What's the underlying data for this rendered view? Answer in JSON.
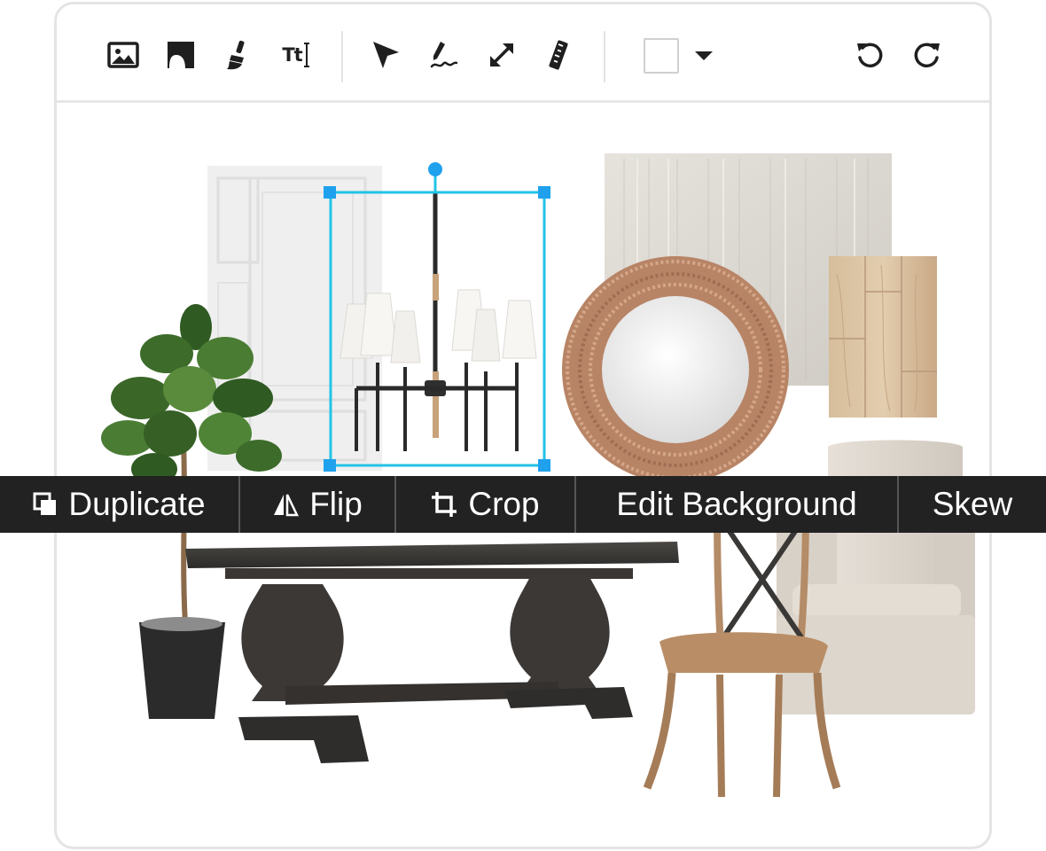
{
  "toolbar": {
    "tools": [
      {
        "icon": "image-icon",
        "label": "Add image"
      },
      {
        "icon": "shape-icon",
        "label": "Add shape"
      },
      {
        "icon": "paint-brush-icon",
        "label": "Paint"
      },
      {
        "icon": "text-icon",
        "label": "Add text",
        "glyph": "Tt"
      },
      {
        "icon": "pointer-icon",
        "label": "Select"
      },
      {
        "icon": "pen-icon",
        "label": "Draw"
      },
      {
        "icon": "resize-arrows-icon",
        "label": "Resize"
      },
      {
        "icon": "ruler-icon",
        "label": "Measure"
      }
    ],
    "color_swatch": "#ffffff",
    "undo_icon": "undo-icon",
    "redo_icon": "redo-icon"
  },
  "colors": {
    "selection": "#22c3e6",
    "handle": "#1fa1ee",
    "context_bar": "#222222",
    "toolbar_divider": "#e6e6e6"
  },
  "context_menu": {
    "items": [
      {
        "icon": "duplicate-icon",
        "label": "Duplicate"
      },
      {
        "icon": "flip-icon",
        "label": "Flip"
      },
      {
        "icon": "crop-icon",
        "label": "Crop"
      },
      {
        "icon": "",
        "label": "Edit Background"
      },
      {
        "icon": "",
        "label": "Skew"
      }
    ]
  },
  "canvas": {
    "items": [
      "wall-panel",
      "chandelier",
      "rug-texture",
      "wood-flooring",
      "round-mirror",
      "fiddle-leaf-plant",
      "dining-table",
      "cross-back-chair",
      "wingback-armchair"
    ],
    "selected_item": "chandelier"
  }
}
